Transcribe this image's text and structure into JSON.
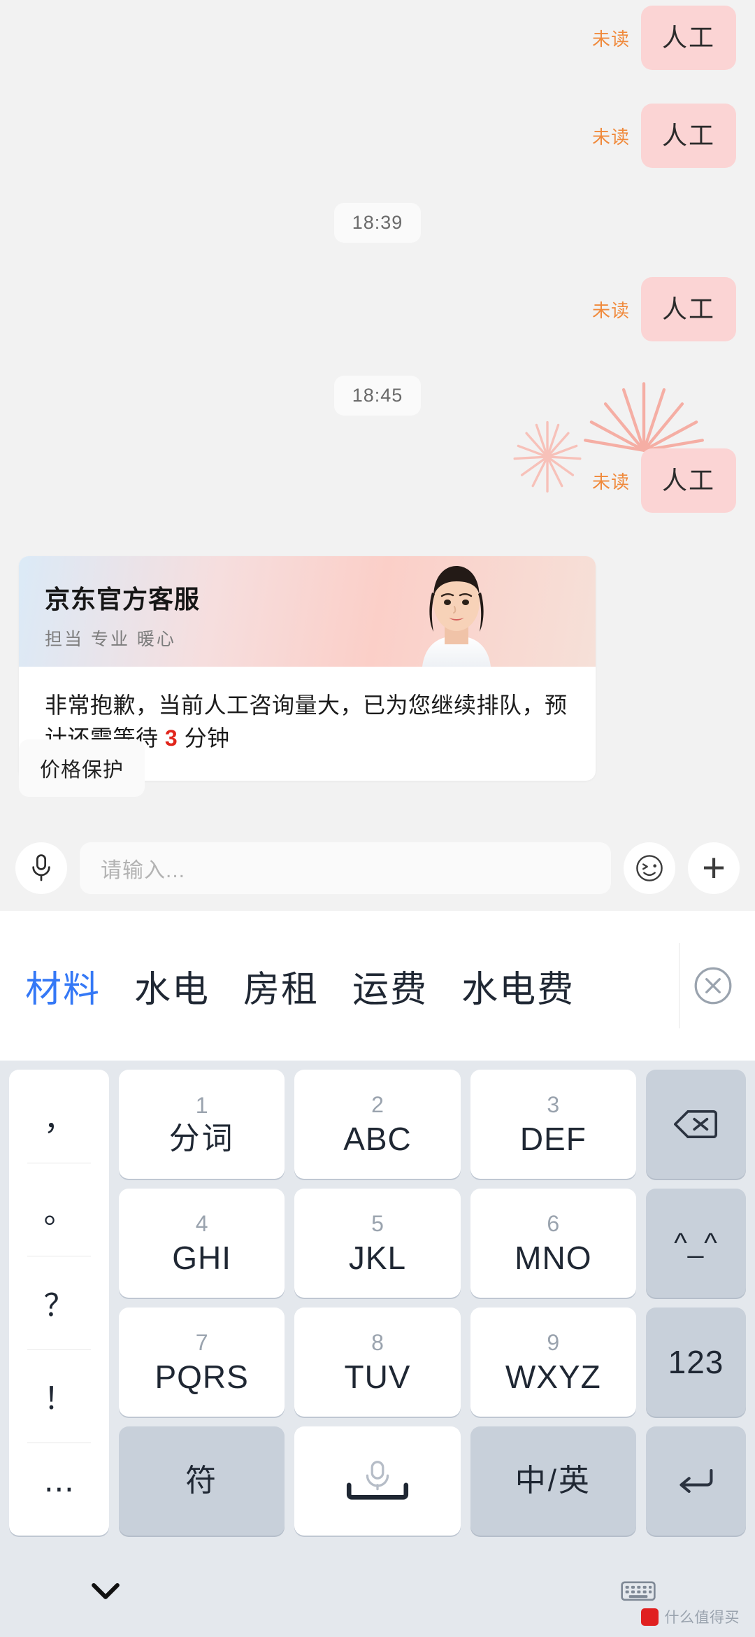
{
  "chat": {
    "messages": [
      {
        "type": "user",
        "text": "人工",
        "status": "未读"
      },
      {
        "type": "user",
        "text": "人工",
        "status": "未读"
      },
      {
        "type": "time",
        "text": "18:39"
      },
      {
        "type": "user",
        "text": "人工",
        "status": "未读"
      },
      {
        "type": "time",
        "text": "18:45"
      },
      {
        "type": "user",
        "text": "人工",
        "status": "未读",
        "firework": true
      }
    ],
    "service_card": {
      "title": "京东官方客服",
      "subtitle": "担当 专业 暖心",
      "body_before": "非常抱歉，当前人工咨询量大，已为您继续排队，预计还需等待 ",
      "body_highlight": "3",
      "body_after": " 分钟",
      "highlight_color": "#e1251b"
    },
    "quick_reply": "价格保护"
  },
  "input_bar": {
    "mic_icon": "microphone-icon",
    "placeholder": "请输入...",
    "emoji_icon": "smiley-face-icon",
    "plus_label": "+"
  },
  "keyboard": {
    "candidates": [
      {
        "text": "材料",
        "selected": true
      },
      {
        "text": "水电",
        "selected": false
      },
      {
        "text": "房租",
        "selected": false
      },
      {
        "text": "运费",
        "selected": false
      },
      {
        "text": "水电费",
        "selected": false
      }
    ],
    "close_icon": "circle-close-icon",
    "mascot_icon": "assistant-mascot-icon",
    "punctuation": [
      "，",
      "。",
      "？",
      "！",
      "⋯"
    ],
    "keys": [
      {
        "num": "1",
        "label": "分词",
        "style": "cn",
        "gray": false
      },
      {
        "num": "2",
        "label": "ABC",
        "style": "",
        "gray": false
      },
      {
        "num": "3",
        "label": "DEF",
        "style": "",
        "gray": false
      },
      {
        "num": "",
        "label": "backspace-icon",
        "style": "icon",
        "gray": true
      },
      {
        "num": "4",
        "label": "GHI",
        "style": "",
        "gray": false
      },
      {
        "num": "5",
        "label": "JKL",
        "style": "",
        "gray": false
      },
      {
        "num": "6",
        "label": "MNO",
        "style": "",
        "gray": false
      },
      {
        "num": "",
        "label": "^_^",
        "style": "small",
        "gray": true
      },
      {
        "num": "7",
        "label": "PQRS",
        "style": "",
        "gray": false
      },
      {
        "num": "8",
        "label": "TUV",
        "style": "",
        "gray": false
      },
      {
        "num": "9",
        "label": "WXYZ",
        "style": "",
        "gray": false
      },
      {
        "num": "",
        "label": "123",
        "style": "",
        "gray": true
      },
      {
        "num": "",
        "label": "符",
        "style": "cn",
        "gray": true
      },
      {
        "num": "",
        "label": "space-mic-icon",
        "style": "icon",
        "gray": false
      },
      {
        "num": "",
        "label": "中/英",
        "style": "cn",
        "gray": true
      },
      {
        "num": "",
        "label": "enter-icon",
        "style": "icon",
        "gray": true
      }
    ],
    "bottom_bar": {
      "hide_icon": "chevron-down-icon",
      "switch_icon": "keyboard-layout-icon"
    }
  },
  "watermark": {
    "text": "什么值得买"
  }
}
